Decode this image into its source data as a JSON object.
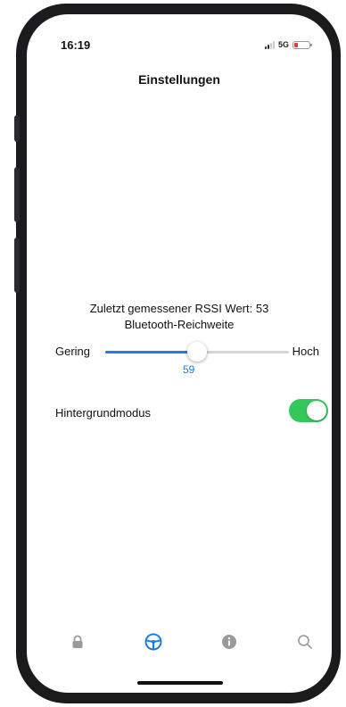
{
  "status_bar": {
    "time": "16:19",
    "network": "5G",
    "signal_bars_active": 2,
    "battery_color": "#e53935"
  },
  "header": {
    "title": "Einstellungen"
  },
  "main": {
    "rssi_text": "Zuletzt gemessener RSSI Wert: 53",
    "range_label": "Bluetooth-Reichweite",
    "slider": {
      "min_label": "Gering",
      "max_label": "Hoch",
      "value": "59",
      "fill_fraction": 0.5,
      "accent_color": "#1e7ee6"
    },
    "background_mode": {
      "label": "Hintergrundmodus",
      "enabled": true,
      "toggle_color": "#34c759"
    }
  },
  "tabbar": {
    "tabs": [
      {
        "icon": "lock-icon",
        "active": false
      },
      {
        "icon": "steering-wheel-icon",
        "active": true
      },
      {
        "icon": "info-icon",
        "active": false
      },
      {
        "icon": "search-icon",
        "active": false
      }
    ],
    "active_color": "#1e7ee6",
    "inactive_color": "#9a9a9a"
  }
}
